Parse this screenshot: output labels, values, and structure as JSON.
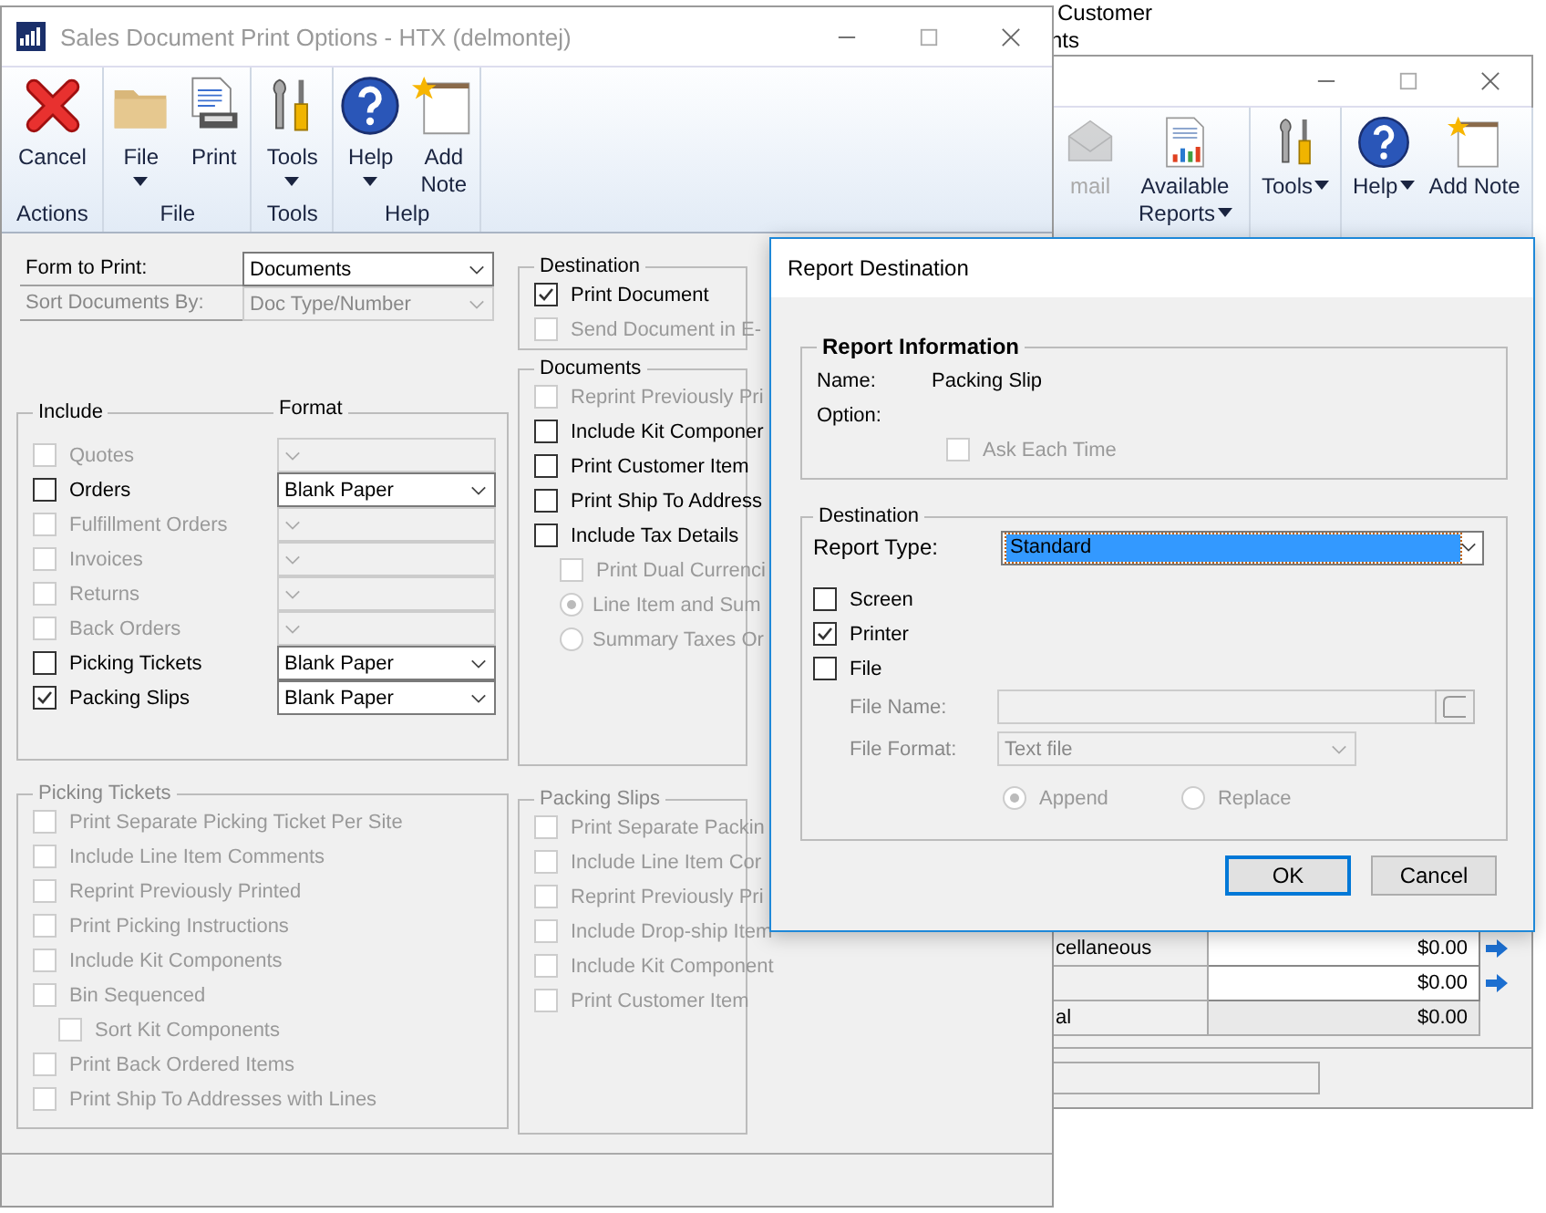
{
  "background": {
    "texts": [
      "Customer",
      "nts"
    ],
    "window": {
      "toolbar": [
        {
          "buttons": [
            {
              "kind": "email",
              "label": "mail",
              "disabled": true,
              "dropdown": false
            },
            {
              "kind": "reports",
              "label": "Available Reports",
              "disabled": false,
              "dropdown": true
            }
          ]
        },
        {
          "buttons": [
            {
              "kind": "tools",
              "label": "Tools",
              "disabled": false,
              "dropdown": true
            }
          ]
        },
        {
          "buttons": [
            {
              "kind": "help",
              "label": "Help",
              "disabled": false,
              "dropdown": true
            },
            {
              "kind": "note",
              "label": "Add Note",
              "disabled": false,
              "dropdown": false
            }
          ]
        }
      ],
      "totals": [
        {
          "label": "cellaneous",
          "amount": "$0.00",
          "editable": true
        },
        {
          "amount": "$0.00",
          "editable": true
        },
        {
          "label": "al",
          "amount": "$0.00",
          "editable": false
        }
      ]
    }
  },
  "window": {
    "title": "Sales Document Print Options  -  HTX (delmontej)"
  },
  "ribbon": [
    {
      "label": "Actions",
      "buttons": [
        {
          "kind": "cancel",
          "label": "Cancel",
          "dropdown": false
        }
      ]
    },
    {
      "label": "File",
      "buttons": [
        {
          "kind": "folder",
          "label": "File",
          "dropdown": true
        },
        {
          "kind": "print",
          "label": "Print",
          "dropdown": false
        }
      ]
    },
    {
      "label": "Tools",
      "buttons": [
        {
          "kind": "tools",
          "label": "Tools",
          "dropdown": true
        }
      ]
    },
    {
      "label": "Help",
      "buttons": [
        {
          "kind": "help",
          "label": "Help",
          "dropdown": true
        },
        {
          "kind": "note",
          "label": "Add Note",
          "dropdown": false
        }
      ]
    }
  ],
  "fields": [
    {
      "label": "Form to Print:",
      "value": "Documents",
      "disabled": false
    },
    {
      "label": "Sort Documents By:",
      "value": "Doc Type/Number",
      "disabled": true
    }
  ],
  "include": {
    "title": "Include",
    "format_title": "Format",
    "items": [
      {
        "label": "Quotes",
        "checked": false,
        "disabled": true
      },
      {
        "label": "Orders",
        "checked": false,
        "disabled": false,
        "format": "Blank Paper"
      },
      {
        "label": "Fulfillment Orders",
        "checked": false,
        "disabled": true
      },
      {
        "label": "Invoices",
        "checked": false,
        "disabled": true
      },
      {
        "label": "Returns",
        "checked": false,
        "disabled": true
      },
      {
        "label": "Back Orders",
        "checked": false,
        "disabled": true
      },
      {
        "label": "Picking Tickets",
        "checked": false,
        "disabled": false,
        "format": "Blank Paper"
      },
      {
        "label": "Packing Slips",
        "checked": true,
        "disabled": false,
        "format": "Blank Paper"
      }
    ]
  },
  "picking_tickets": {
    "title": "Picking Tickets",
    "disabled": true,
    "items": [
      {
        "label": "Print Separate Picking Ticket Per Site",
        "checked": false,
        "disabled": true
      },
      {
        "label": "Include Line Item Comments",
        "checked": false,
        "disabled": true
      },
      {
        "label": "Reprint Previously Printed",
        "checked": false,
        "disabled": true
      },
      {
        "label": "Print Picking Instructions",
        "checked": false,
        "disabled": true
      },
      {
        "label": "Include Kit Components",
        "checked": false,
        "disabled": true
      },
      {
        "label": "Bin Sequenced",
        "checked": false,
        "disabled": true,
        "children": [
          {
            "label": "Sort Kit Components",
            "checked": false,
            "disabled": true
          }
        ]
      },
      {
        "label": "Print Back Ordered Items",
        "checked": false,
        "disabled": true
      },
      {
        "label": "Print Ship To Addresses with Lines",
        "checked": false,
        "disabled": true
      }
    ]
  },
  "destination": {
    "title": "Destination",
    "disabled": false,
    "items": [
      {
        "label": "Print Document",
        "checked": true,
        "disabled": false
      },
      {
        "label": "Send Document in E-",
        "checked": false,
        "disabled": true
      }
    ]
  },
  "documents": {
    "title": "Documents",
    "disabled": false,
    "items": [
      {
        "label": "Reprint Previously Pri",
        "checked": false,
        "disabled": true
      },
      {
        "label": "Include Kit Componer",
        "checked": false,
        "disabled": false
      },
      {
        "label": "Print Customer Item",
        "checked": false,
        "disabled": false
      },
      {
        "label": "Print Ship To Address",
        "checked": false,
        "disabled": false
      },
      {
        "label": "Include Tax Details",
        "checked": false,
        "disabled": false,
        "children": [
          {
            "label": "Print Dual Currenci",
            "checked": false,
            "disabled": true
          }
        ],
        "choices": [
          {
            "label": "Line Item and Sum",
            "selected": true,
            "disabled": true
          },
          {
            "label": "Summary Taxes Or",
            "selected": false,
            "disabled": true
          }
        ]
      }
    ]
  },
  "packing_slips": {
    "title": "Packing Slips",
    "disabled": true,
    "items": [
      {
        "label": "Print Separate Packin",
        "checked": false,
        "disabled": true
      },
      {
        "label": "Include Line Item Cor",
        "checked": false,
        "disabled": true
      },
      {
        "label": "Reprint Previously Pri",
        "checked": false,
        "disabled": true
      },
      {
        "label": "Include Drop-ship Item",
        "checked": false,
        "disabled": true
      },
      {
        "label": "Include Kit Component",
        "checked": false,
        "disabled": true
      },
      {
        "label": "Print Customer Item",
        "checked": false,
        "disabled": true
      }
    ]
  },
  "dialog": {
    "title": "Report Destination",
    "report_information": {
      "title": "Report Information",
      "fields": [
        {
          "label": "Name:",
          "value": "Packing Slip"
        },
        {
          "label": "Option:"
        }
      ],
      "ask_each_time": {
        "label": "Ask Each Time",
        "checked": false,
        "disabled": true
      }
    },
    "destination": {
      "title": "Destination",
      "report_type": {
        "label": "Report Type:",
        "value": "Standard",
        "focused": true
      },
      "outputs": [
        {
          "label": "Screen",
          "checked": false
        },
        {
          "label": "Printer",
          "checked": true
        },
        {
          "label": "File",
          "checked": false
        }
      ],
      "file_name": {
        "label": "File Name:",
        "disabled": true
      },
      "file_format": {
        "label": "File Format:",
        "value": "Text file",
        "disabled": true
      },
      "modes": [
        {
          "label": "Append",
          "selected": true,
          "disabled": true
        },
        {
          "label": "Replace",
          "selected": false,
          "disabled": true
        }
      ]
    },
    "buttons": [
      {
        "label": "OK",
        "default": true
      },
      {
        "label": "Cancel",
        "default": false
      }
    ]
  }
}
